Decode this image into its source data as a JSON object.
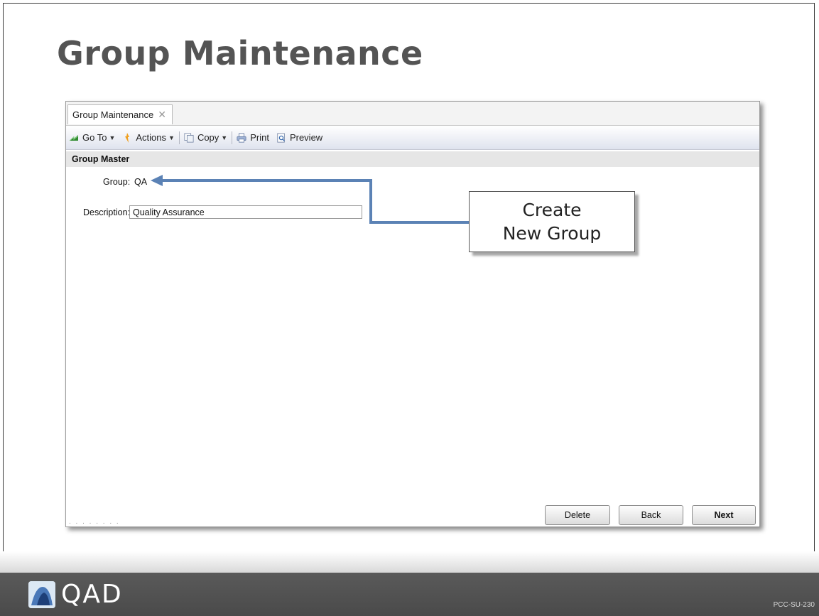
{
  "slide": {
    "title": "Group Maintenance",
    "slide_code": "PCC-SU-230",
    "logo_text": "QAD"
  },
  "window": {
    "tab_label": "Group Maintenance",
    "tab_close": "✕"
  },
  "toolbar": {
    "goto_label": "Go To",
    "actions_label": "Actions",
    "copy_label": "Copy",
    "print_label": "Print",
    "preview_label": "Preview"
  },
  "form": {
    "section_title": "Group Master",
    "group_label": "Group:",
    "group_value": "QA",
    "description_label": "Description:",
    "description_value": "Quality Assurance"
  },
  "buttons": {
    "delete": "Delete",
    "back": "Back",
    "next": "Next"
  },
  "callout": {
    "line1": "Create",
    "line2": "New Group"
  },
  "colors": {
    "arrow": "#5b82b5",
    "title": "#545454",
    "footer": "#4f4f4f"
  },
  "icons": [
    "goto-icon",
    "actions-icon",
    "copy-icon",
    "print-icon",
    "preview-icon",
    "close-icon",
    "qad-logo-icon"
  ]
}
